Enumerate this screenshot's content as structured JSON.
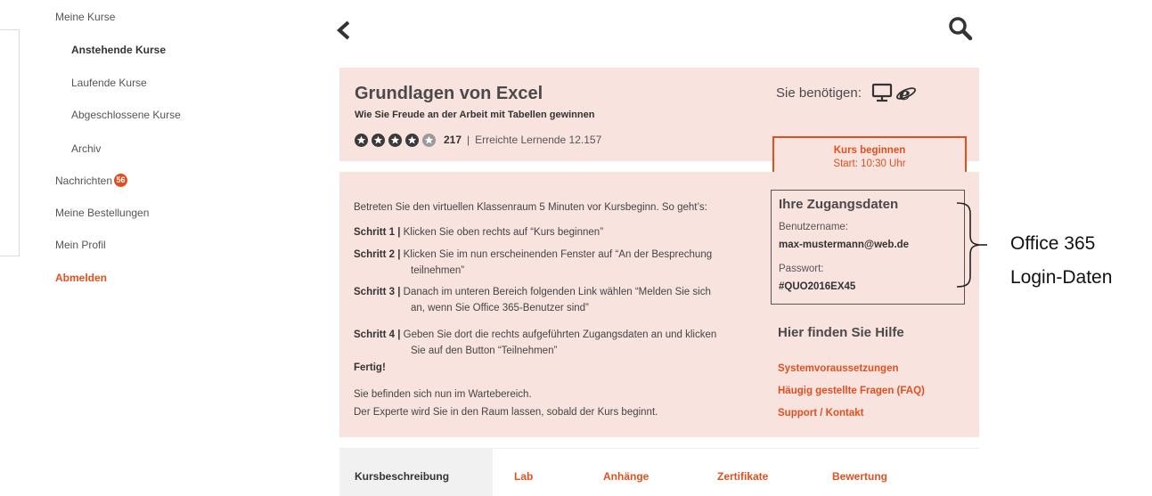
{
  "sidebar": {
    "items": [
      {
        "label": "Meine Kurse"
      },
      {
        "label": "Anstehende Kurse"
      },
      {
        "label": "Laufende Kurse"
      },
      {
        "label": "Abgeschlossene Kurse"
      },
      {
        "label": "Archiv"
      },
      {
        "label": "Nachrichten",
        "badge": "56"
      },
      {
        "label": "Meine Bestellungen"
      },
      {
        "label": "Mein Profil"
      },
      {
        "label": "Abmelden"
      }
    ]
  },
  "course": {
    "title": "Grundlagen von Excel",
    "subtitle": "Wie Sie Freude an der Arbeit mit Tabellen gewinnen",
    "rating": {
      "value": 4,
      "max": 5,
      "count": "217"
    },
    "separator": "|",
    "learners": "Erreichte Lernende 12.157",
    "needs_label": "Sie benötigen:",
    "needs_icons": [
      "monitor-icon",
      "internet-explorer-icon"
    ],
    "start_button": {
      "label": "Kurs beginnen",
      "time": "Start:  10:30 Uhr"
    }
  },
  "instructions": {
    "intro": "Betreten Sie den virtuellen Klassenraum 5 Minuten vor Kursbeginn. So geht’s:",
    "steps": [
      {
        "label": "Schritt 1 |",
        "line1": "Klicken Sie oben rechts auf “Kurs beginnen”",
        "line2": ""
      },
      {
        "label": "Schritt 2 |",
        "line1": "Klicken Sie im nun erscheinenden Fenster auf “An der Besprechung",
        "line2": "teilnehmen”"
      },
      {
        "label": "Schritt 3 |",
        "line1": "Danach im unteren Bereich folgenden  Link wählen  “Melden Sie sich",
        "line2": "an, wenn  Sie Office 365-Benutzer sind”"
      },
      {
        "label": "Schritt 4 |",
        "line1": "Geben Sie dort die rechts aufgeführten Zugangsdaten an und klicken",
        "line2": "Sie auf den Button “Teilnehmen”"
      }
    ],
    "done": "Fertig!",
    "wait1": "Sie befinden sich nun im Wartebereich.",
    "wait2": "Der Experte wird Sie in den Raum lassen, sobald der Kurs beginnt."
  },
  "access": {
    "title": "Ihre Zugangsdaten",
    "username_label": "Benutzername:",
    "username": "max-mustermann@web.de",
    "password_label": "Passwort:",
    "password": "#QUO2016EX45"
  },
  "help": {
    "title": "Hier finden Sie Hilfe",
    "links": [
      "Systemvoraussetzungen",
      "Häugig gestellte Fragen (FAQ)",
      "Support / Kontakt"
    ]
  },
  "annotation": {
    "line1": "Office 365",
    "line2": "Login-Daten"
  },
  "tabs": [
    "Kursbeschreibung",
    "Lab",
    "Anhänge",
    "Zertifikate",
    "Bewertung"
  ],
  "colors": {
    "accent": "#e0501f",
    "panel": "#f8e3df",
    "tab_active": "#f1f1f1"
  }
}
